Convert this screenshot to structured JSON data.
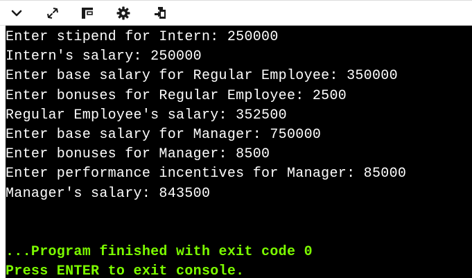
{
  "toolbar": {
    "buttons": [
      {
        "icon": "chevron-down-icon"
      },
      {
        "icon": "expand-icon"
      },
      {
        "icon": "layout-icon"
      },
      {
        "icon": "gear-icon"
      },
      {
        "icon": "share-icon"
      }
    ]
  },
  "console": {
    "background_color": "#000000",
    "text_color": "#ffffff",
    "status_color": "#7cfc00",
    "output_lines": [
      "Enter stipend for Intern: 250000",
      "Intern's salary: 250000",
      "Enter base salary for Regular Employee: 350000",
      "Enter bonuses for Regular Employee: 2500",
      "Regular Employee's salary: 352500",
      "Enter base salary for Manager: 750000",
      "Enter bonuses for Manager: 8500",
      "Enter performance incentives for Manager: 85000",
      "Manager's salary: 843500"
    ],
    "status_lines": [
      "...Program finished with exit code 0",
      "Press ENTER to exit console."
    ]
  }
}
